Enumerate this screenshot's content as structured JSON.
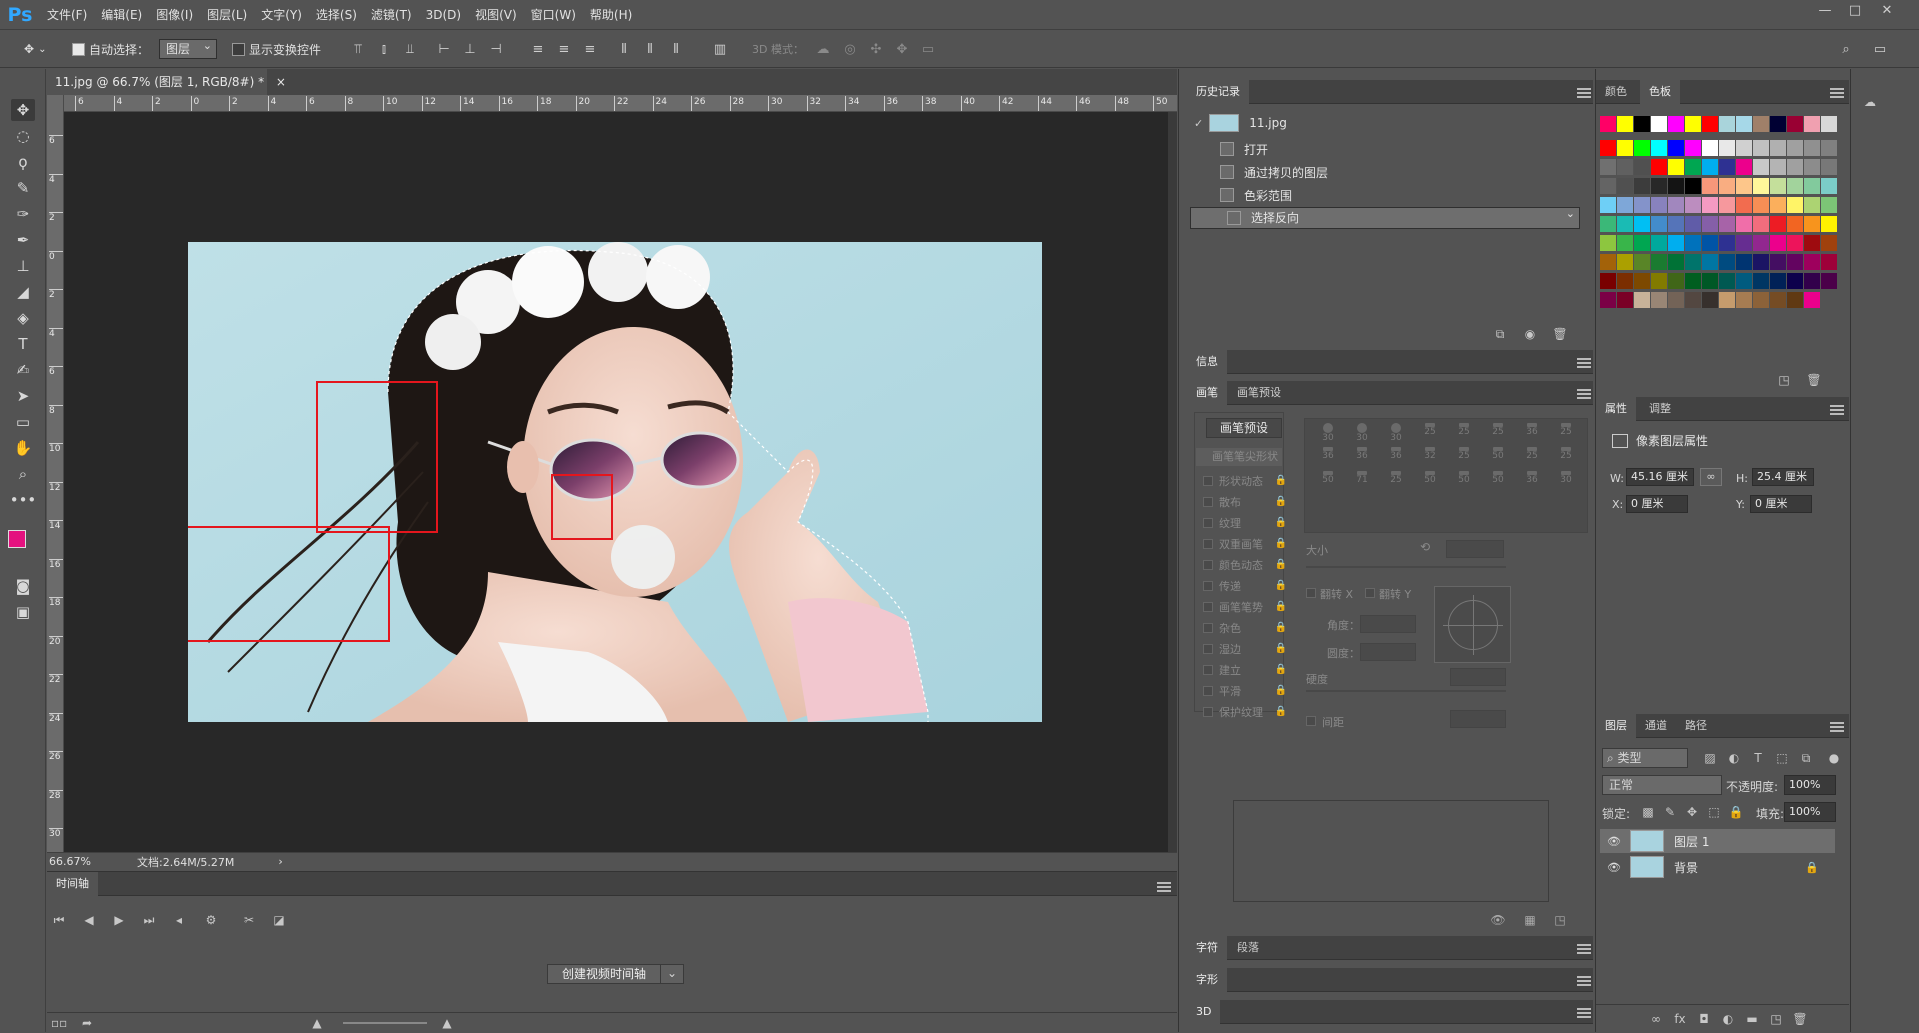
{
  "app": {
    "logo": "Ps"
  },
  "menu": [
    "文件(F)",
    "编辑(E)",
    "图像(I)",
    "图层(L)",
    "文字(Y)",
    "选择(S)",
    "滤镜(T)",
    "3D(D)",
    "视图(V)",
    "窗口(W)",
    "帮助(H)"
  ],
  "window_controls": {
    "minimize": "—",
    "maximize": "□",
    "close": "✕"
  },
  "options": {
    "auto_select_label": "自动选择：",
    "auto_select_checked": true,
    "auto_select_target": "图层",
    "show_transform_label": "显示变换控件",
    "show_transform_checked": false,
    "mode_3d_label": "3D 模式："
  },
  "document": {
    "tab_title": "11.jpg @ 66.7% (图层 1, RGB/8#) *",
    "close": "×",
    "zoom": "66.67%",
    "doc_size": "文档:2.64M/5.27M"
  },
  "ruler_h": [
    "6",
    "4",
    "2",
    "0",
    "2",
    "4",
    "6",
    "8",
    "10",
    "12",
    "14",
    "16",
    "18",
    "20",
    "22",
    "24",
    "26",
    "28",
    "30",
    "32",
    "34",
    "36",
    "38",
    "40",
    "42",
    "44",
    "46",
    "48",
    "50"
  ],
  "ruler_v": [
    "6",
    "4",
    "2",
    "0",
    "2",
    "4",
    "6",
    "8",
    "10",
    "12",
    "14",
    "16",
    "18",
    "20",
    "22",
    "24",
    "26",
    "28",
    "30"
  ],
  "timeline": {
    "tab": "时间轴",
    "create_button": "创建视频时间轴",
    "dropdown": "⌄"
  },
  "history": {
    "tab": "历史记录",
    "snapshot": "11.jpg",
    "items": [
      "打开",
      "通过拷贝的图层",
      "色彩范围",
      "选择反向"
    ]
  },
  "info": {
    "tab": "信息"
  },
  "brush": {
    "tabs": [
      "画笔",
      "画笔预设"
    ],
    "preset_button": "画笔预设",
    "tip_shape": "画笔笔尖形状",
    "options": [
      "形状动态",
      "散布",
      "纹理",
      "双重画笔",
      "颜色动态",
      "传递",
      "画笔笔势",
      "杂色",
      "湿边",
      "建立",
      "平滑",
      "保护纹理"
    ],
    "size_label": "大小",
    "flip_x": "翻转 X",
    "flip_y": "翻转 Y",
    "angle": "角度：",
    "roundness": "圆度：",
    "hardness": "硬度",
    "spacing": "间距",
    "tip_numbers": [
      "30",
      "30",
      "30",
      "25",
      "25",
      "25",
      "36",
      "25",
      "36",
      "36",
      "36",
      "32",
      "25",
      "50",
      "25",
      "25",
      "50",
      "71",
      "25",
      "50",
      "50",
      "50",
      "36",
      "30"
    ]
  },
  "character": {
    "tabs": [
      "字符",
      "段落"
    ]
  },
  "glyphs": {
    "tab": "字形"
  },
  "panel_3d": {
    "tab": "3D"
  },
  "color": {
    "tabs": [
      "颜色",
      "色板"
    ]
  },
  "properties": {
    "tabs": [
      "属性",
      "调整"
    ],
    "title": "像素图层属性",
    "w_label": "W:",
    "w_value": "45.16 厘米",
    "h_label": "H:",
    "h_value": "25.4 厘米",
    "x_label": "X:",
    "x_value": "0 厘米",
    "y_label": "Y:",
    "y_value": "0 厘米"
  },
  "layers": {
    "tabs": [
      "图层",
      "通道",
      "路径"
    ],
    "filter_kind": "类型",
    "blend_mode": "正常",
    "opacity_label": "不透明度:",
    "opacity": "100%",
    "lock_label": "锁定:",
    "fill_label": "填充:",
    "fill": "100%",
    "items": [
      {
        "name": "图层 1"
      },
      {
        "name": "背景"
      }
    ]
  },
  "colors": {
    "foreground": "#e4117f",
    "background": "#ffffff",
    "selection": "#e4161d",
    "accent": "#31a8ff"
  },
  "swatch_rows": [
    [
      "#ff0066",
      "#ffff00",
      "#000000",
      "#ffffff",
      "#ff00ff",
      "#ffff00",
      "#ff0000",
      "#a9d4db",
      "#a6d8e8",
      "#a08069",
      "#000033",
      "#990033",
      "#f0a0b0",
      "#d8d8d8"
    ],
    [
      "#ff0000",
      "#ffff00",
      "#00ff00",
      "#00ffff",
      "#0000ff",
      "#ff00ff",
      "#ffffff",
      "#e8e8e8",
      "#d0d0d0",
      "#c0c0c0",
      "#b0b0b0",
      "#a0a0a0",
      "#909090",
      "#808080"
    ],
    [
      "#707070",
      "#606060",
      "#505050",
      "#ff0000",
      "#ffff00",
      "#00a651",
      "#00aeef",
      "#2e3192",
      "#ec008c",
      "#c8c8c8",
      "#b4b4b4",
      "#a0a0a0",
      "#8c8c8c",
      "#787878"
    ],
    [
      "#646464",
      "#505050",
      "#3c3c3c",
      "#282828",
      "#141414",
      "#000000",
      "#f7977a",
      "#f9ad81",
      "#fdc68a",
      "#fff79a",
      "#c4df9b",
      "#a2d39c",
      "#82ca9d",
      "#7bcdc8"
    ],
    [
      "#6ecff6",
      "#7ea7d8",
      "#8493ca",
      "#8882be",
      "#a187be",
      "#bc8dbf",
      "#f49ac2",
      "#f6989d",
      "#f26c4f",
      "#f68e55",
      "#fbaf5c",
      "#fff467",
      "#acd372",
      "#7cc576"
    ],
    [
      "#3bb878",
      "#1abbb4",
      "#00bff3",
      "#438ccb",
      "#5574b9",
      "#605ca8",
      "#855fa8",
      "#a763a8",
      "#f06ea9",
      "#f26d7d",
      "#ed1c24",
      "#f26522",
      "#f7941d",
      "#fff200"
    ],
    [
      "#8dc63f",
      "#39b54a",
      "#00a651",
      "#00a99d",
      "#00aeef",
      "#0072bc",
      "#0054a6",
      "#2e3192",
      "#662d91",
      "#92278f",
      "#ec008c",
      "#ed145b",
      "#9e0b0f",
      "#a0410d"
    ],
    [
      "#a36209",
      "#aba000",
      "#598527",
      "#1a7b30",
      "#007236",
      "#00746b",
      "#0076a3",
      "#004b80",
      "#003471",
      "#1b1464",
      "#440e62",
      "#630460",
      "#9e005d",
      "#9e0039"
    ],
    [
      "#790000",
      "#7b2e00",
      "#7d4900",
      "#827b00",
      "#406618",
      "#005e20",
      "#005826",
      "#005952",
      "#005b7f",
      "#003663",
      "#002157",
      "#0d004c",
      "#32004b",
      "#4b0049"
    ],
    [
      "#7b0046",
      "#7a0026",
      "#c7b299",
      "#998675",
      "#736357",
      "#534741",
      "#37302d",
      "#c69c6d",
      "#a67c52",
      "#8c6239",
      "#754c24",
      "#603913",
      "#ec008c"
    ]
  ]
}
